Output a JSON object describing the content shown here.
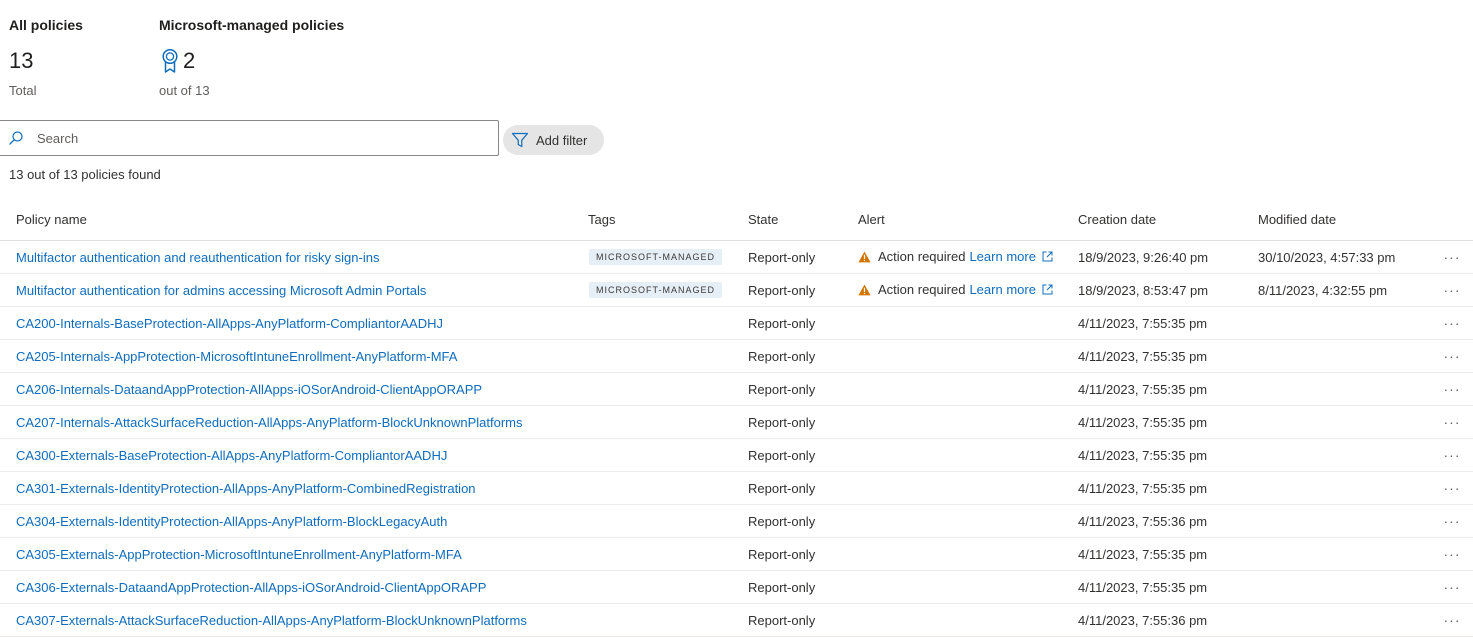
{
  "summary": {
    "all_policies": {
      "title": "All policies",
      "count": "13",
      "sub": "Total"
    },
    "managed_policies": {
      "title": "Microsoft-managed policies",
      "count": "2",
      "sub": "out of 13",
      "icon": "ribbon-badge-icon"
    }
  },
  "search": {
    "placeholder": "Search",
    "value": ""
  },
  "filter": {
    "label": "Add filter",
    "icon": "filter-icon"
  },
  "result_count": "13 out of 13 policies found",
  "colors": {
    "link": "#0f6cbd",
    "warning": "#d47500",
    "tag_bg": "#e6eef6",
    "filter_bg": "#e5e5e5"
  },
  "table": {
    "headers": {
      "name": "Policy name",
      "tags": "Tags",
      "state": "State",
      "alert": "Alert",
      "created": "Creation date",
      "modified": "Modified date"
    },
    "rows": [
      {
        "name": "Multifactor authentication and reauthentication for risky sign-ins",
        "tag": "MICROSOFT-MANAGED",
        "state": "Report-only",
        "alert": "Action required",
        "alert_link": "Learn more",
        "created": "18/9/2023, 9:26:40 pm",
        "modified": "30/10/2023, 4:57:33 pm"
      },
      {
        "name": "Multifactor authentication for admins accessing Microsoft Admin Portals",
        "tag": "MICROSOFT-MANAGED",
        "state": "Report-only",
        "alert": "Action required",
        "alert_link": "Learn more",
        "created": "18/9/2023, 8:53:47 pm",
        "modified": "8/11/2023, 4:32:55 pm"
      },
      {
        "name": "CA200-Internals-BaseProtection-AllApps-AnyPlatform-CompliantorAADHJ",
        "tag": "",
        "state": "Report-only",
        "alert": "",
        "alert_link": "",
        "created": "4/11/2023, 7:55:35 pm",
        "modified": ""
      },
      {
        "name": "CA205-Internals-AppProtection-MicrosoftIntuneEnrollment-AnyPlatform-MFA",
        "tag": "",
        "state": "Report-only",
        "alert": "",
        "alert_link": "",
        "created": "4/11/2023, 7:55:35 pm",
        "modified": ""
      },
      {
        "name": "CA206-Internals-DataandAppProtection-AllApps-iOSorAndroid-ClientAppORAPP",
        "tag": "",
        "state": "Report-only",
        "alert": "",
        "alert_link": "",
        "created": "4/11/2023, 7:55:35 pm",
        "modified": ""
      },
      {
        "name": "CA207-Internals-AttackSurfaceReduction-AllApps-AnyPlatform-BlockUnknownPlatforms",
        "tag": "",
        "state": "Report-only",
        "alert": "",
        "alert_link": "",
        "created": "4/11/2023, 7:55:35 pm",
        "modified": ""
      },
      {
        "name": "CA300-Externals-BaseProtection-AllApps-AnyPlatform-CompliantorAADHJ",
        "tag": "",
        "state": "Report-only",
        "alert": "",
        "alert_link": "",
        "created": "4/11/2023, 7:55:35 pm",
        "modified": ""
      },
      {
        "name": "CA301-Externals-IdentityProtection-AllApps-AnyPlatform-CombinedRegistration",
        "tag": "",
        "state": "Report-only",
        "alert": "",
        "alert_link": "",
        "created": "4/11/2023, 7:55:35 pm",
        "modified": ""
      },
      {
        "name": "CA304-Externals-IdentityProtection-AllApps-AnyPlatform-BlockLegacyAuth",
        "tag": "",
        "state": "Report-only",
        "alert": "",
        "alert_link": "",
        "created": "4/11/2023, 7:55:36 pm",
        "modified": ""
      },
      {
        "name": "CA305-Externals-AppProtection-MicrosoftIntuneEnrollment-AnyPlatform-MFA",
        "tag": "",
        "state": "Report-only",
        "alert": "",
        "alert_link": "",
        "created": "4/11/2023, 7:55:35 pm",
        "modified": ""
      },
      {
        "name": "CA306-Externals-DataandAppProtection-AllApps-iOSorAndroid-ClientAppORAPP",
        "tag": "",
        "state": "Report-only",
        "alert": "",
        "alert_link": "",
        "created": "4/11/2023, 7:55:35 pm",
        "modified": ""
      },
      {
        "name": "CA307-Externals-AttackSurfaceReduction-AllApps-AnyPlatform-BlockUnknownPlatforms",
        "tag": "",
        "state": "Report-only",
        "alert": "",
        "alert_link": "",
        "created": "4/11/2023, 7:55:36 pm",
        "modified": ""
      }
    ],
    "row_menu_icon": "more-options-icon"
  }
}
